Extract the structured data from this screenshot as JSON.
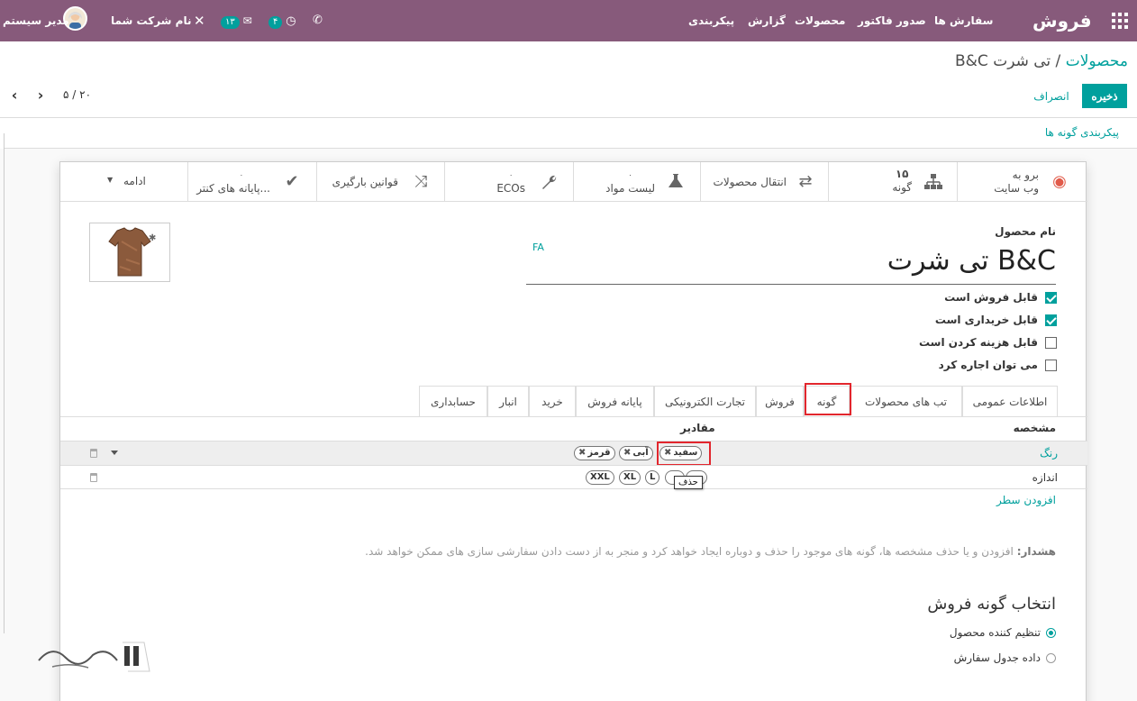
{
  "navbar": {
    "app_title": "فروش",
    "menu": [
      "سفارش ها",
      "صدور فاکتور",
      "محصولات",
      "گزارش",
      "پیکربندی"
    ],
    "company": "نام شرکت شما",
    "user": "مدیر سیستم",
    "messages_count": "۱۳",
    "activities_count": "۴"
  },
  "breadcrumb": {
    "parent": "محصولات",
    "separator": "/",
    "current": "تی شرت B&C"
  },
  "buttons": {
    "save": "ذخیره",
    "discard": "انصراف"
  },
  "pager": {
    "value": "۵ / ۲۰",
    "prev": "‹",
    "next": "›"
  },
  "statusbar": {
    "configure_variants": "پیکربندی گونه ها"
  },
  "smart_buttons": {
    "website": {
      "line1": "برو به",
      "line2": "وب سایت"
    },
    "variants": {
      "count": "۱۵",
      "label": "گونه"
    },
    "moves": {
      "label": "انتقال محصولات"
    },
    "bom": {
      "count": "۰",
      "label": "لیست مواد"
    },
    "ecos": {
      "count": "۰",
      "label": "ECOs"
    },
    "putaway": {
      "label": "قوانین بارگیری"
    },
    "pos": {
      "count": "۰",
      "label": "پایانه های کنتر..."
    },
    "more": {
      "label": "ادامه"
    }
  },
  "form": {
    "name_label": "نام محصول",
    "name_value": "تی شرت B&C",
    "lang": "FA",
    "checkboxes": [
      {
        "label": "قابل فروش است",
        "checked": true
      },
      {
        "label": "قابل خریداری است",
        "checked": true
      },
      {
        "label": "قابل هزینه کردن است",
        "checked": false
      },
      {
        "label": "می توان اجاره کرد",
        "checked": false
      }
    ]
  },
  "tabs": [
    "اطلاعات عمومی",
    "تب های محصولات",
    "گونه",
    "فروش",
    "تجارت الکترونیکی",
    "پایانه فروش",
    "خرید",
    "انبار",
    "حسابداری"
  ],
  "active_tab": "گونه",
  "attributes": {
    "col_attribute": "مشخصه",
    "col_values": "مقادیر",
    "rows": [
      {
        "name": "رنگ",
        "values": [
          "سفید",
          "آبی",
          "قرمز"
        ]
      },
      {
        "name": "اندازه",
        "values": [
          "S",
          "M",
          "L",
          "XL",
          "XXL"
        ]
      }
    ],
    "add_line": "افزودن سطر",
    "tooltip": "حذف"
  },
  "warning": {
    "label": "هشدار:",
    "text": "افزودن و یا حذف مشخصه ها، گونه های موجود را حذف و دوباره ایجاد خواهد کرد و منجر به از دست دادن سفارشی سازی های ممکن خواهد شد."
  },
  "variant_selection": {
    "title": "انتخاب گونه فروش",
    "options": [
      {
        "label": "تنظیم کننده محصول",
        "selected": true
      },
      {
        "label": "داده جدول سفارش",
        "selected": false
      }
    ]
  },
  "colors": {
    "navbar": "#875a7b",
    "accent": "#00a09d",
    "highlight": "#e2262d"
  }
}
